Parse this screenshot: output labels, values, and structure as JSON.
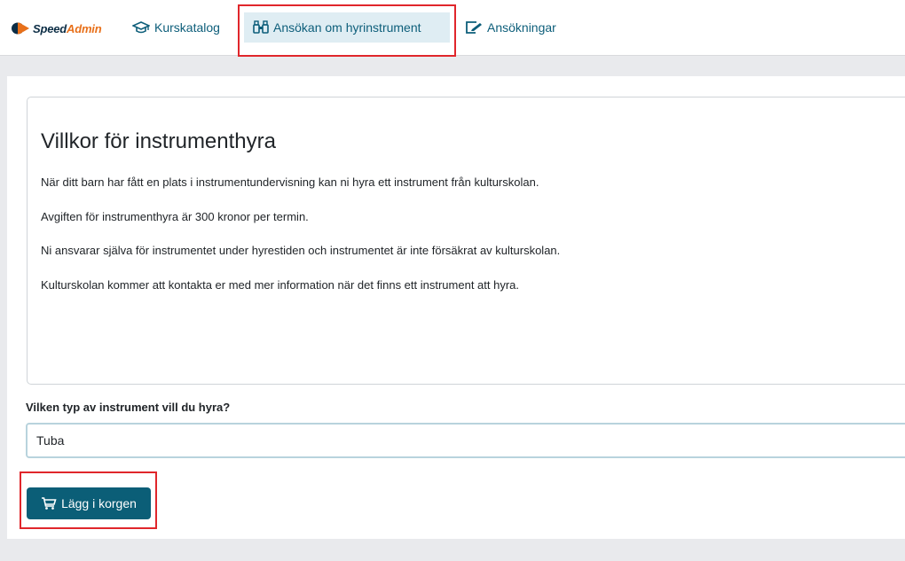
{
  "brand": {
    "speed": "Speed",
    "admin": "Admin",
    "logo_icon": "speedadmin-logo-icon"
  },
  "nav": {
    "items": [
      {
        "label": "Kurskatalog",
        "icon": "graduation-cap-icon"
      },
      {
        "label": "Ansökan om hyrinstrument",
        "icon": "binoculars-icon",
        "active": true
      },
      {
        "label": "Ansökningar",
        "icon": "edit-document-icon"
      }
    ]
  },
  "terms": {
    "title": "Villkor för instrumenthyra",
    "paragraphs": [
      "När ditt barn har fått en plats i instrumentundervisning kan ni hyra ett instrument från kulturskolan.",
      "Avgiften för instrumenthyra är 300 kronor per termin.",
      "Ni ansvarar själva för instrumentet under hyrestiden och instrumentet är inte försäkrat av kulturskolan.",
      "Kulturskolan kommer att kontakta er med mer information när det finns ett instrument att hyra."
    ]
  },
  "instrument": {
    "label": "Vilken typ av instrument vill du hyra?",
    "selected": "Tuba"
  },
  "cart_button": {
    "label": "Lägg i korgen",
    "icon": "cart-icon"
  },
  "colors": {
    "accent": "#0b5e77",
    "nav_text": "#0d5e7a",
    "active_tab_bg": "#dfedf3",
    "highlight": "#e0262b",
    "brand_dark": "#0c2d45",
    "brand_orange": "#e8701a"
  }
}
